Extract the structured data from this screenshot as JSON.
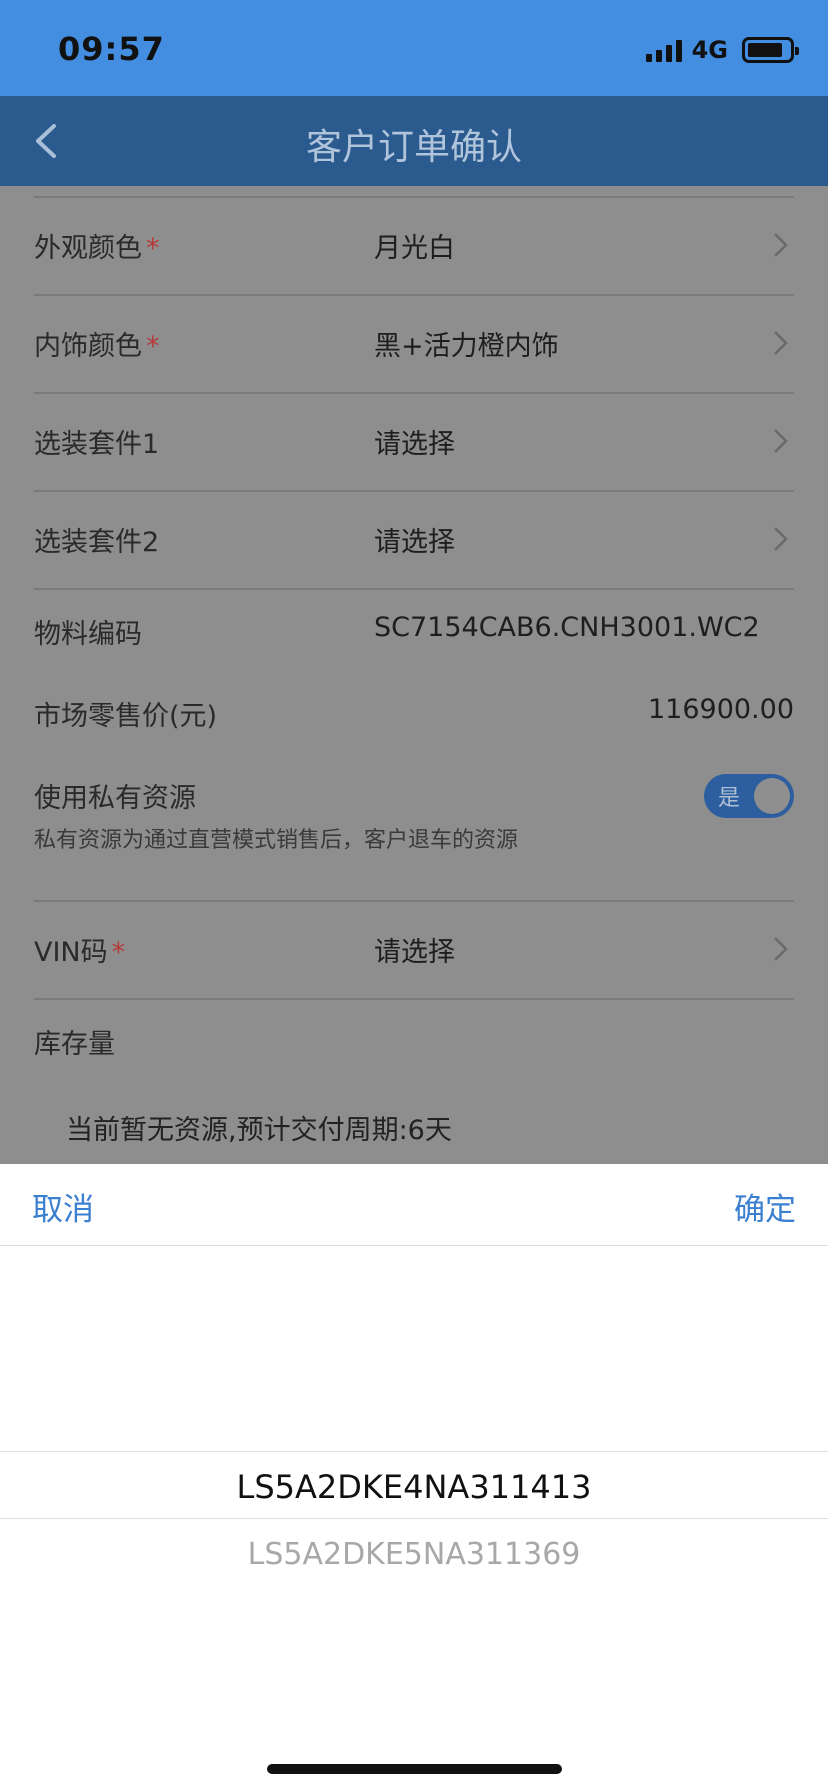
{
  "status_bar": {
    "time": "09:57",
    "network": "4G"
  },
  "nav": {
    "title": "客户订单确认",
    "back_icon": "chevron-left-icon"
  },
  "form": {
    "exterior_color": {
      "label": "外观颜色",
      "required": "*",
      "value": "月光白"
    },
    "interior_color": {
      "label": "内饰颜色",
      "required": "*",
      "value": "黑+活力橙内饰"
    },
    "option_pkg_1": {
      "label": "选装套件1",
      "value": "请选择"
    },
    "option_pkg_2": {
      "label": "选装套件2",
      "value": "请选择"
    },
    "material_code": {
      "label": "物料编码",
      "value": "SC7154CAB6.CNH3001.WC2"
    },
    "retail_price": {
      "label": "市场零售价(元)",
      "value": "116900.00"
    },
    "private_resource": {
      "label": "使用私有资源",
      "hint": "私有资源为通过直营模式销售后，客户退车的资源",
      "toggle_text": "是",
      "enabled": true
    },
    "vin": {
      "label": "VIN码",
      "required": "*",
      "value": "请选择"
    },
    "stock": {
      "label": "库存量",
      "message": "当前暂无资源,预计交付周期:6天"
    }
  },
  "picker": {
    "cancel_label": "取消",
    "confirm_label": "确定",
    "options": [
      "LS5A2DKE4NA311413",
      "LS5A2DKE5NA311369"
    ],
    "selected_index": 0
  },
  "colors": {
    "status_bar": "#438ee0",
    "nav_bar": "#2a5a8e",
    "accent": "#3b7fd1",
    "required": "#b73a3a",
    "overlay_bg": "#8e8e8e"
  }
}
